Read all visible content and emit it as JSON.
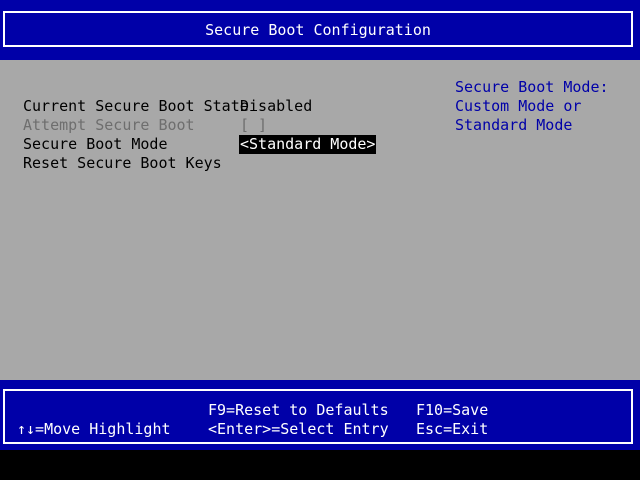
{
  "header": {
    "title": "Secure Boot Configuration"
  },
  "settings": [
    {
      "label": "Current Secure Boot State",
      "value": "Disabled",
      "enabled": true,
      "selected": false
    },
    {
      "label": "Attempt Secure Boot",
      "value": "[ ]",
      "enabled": false,
      "selected": false
    },
    {
      "label": "Secure Boot Mode",
      "value": "<Standard Mode>",
      "enabled": true,
      "selected": true
    },
    {
      "label": "Reset Secure Boot Keys",
      "value": "",
      "enabled": true,
      "selected": false
    }
  ],
  "help": {
    "lines": [
      "Secure Boot Mode:",
      "Custom Mode or",
      "Standard Mode"
    ]
  },
  "footer": {
    "move_highlight": "↑↓=Move Highlight",
    "reset_defaults": "F9=Reset to Defaults",
    "select_entry": "<Enter>=Select Entry",
    "save": "F10=Save",
    "exit": "Esc=Exit"
  },
  "colors": {
    "header_bg": "#0000a8",
    "main_bg": "#a8a8a8",
    "help_text": "#0000a8",
    "disabled_text": "#6e6e6e"
  }
}
